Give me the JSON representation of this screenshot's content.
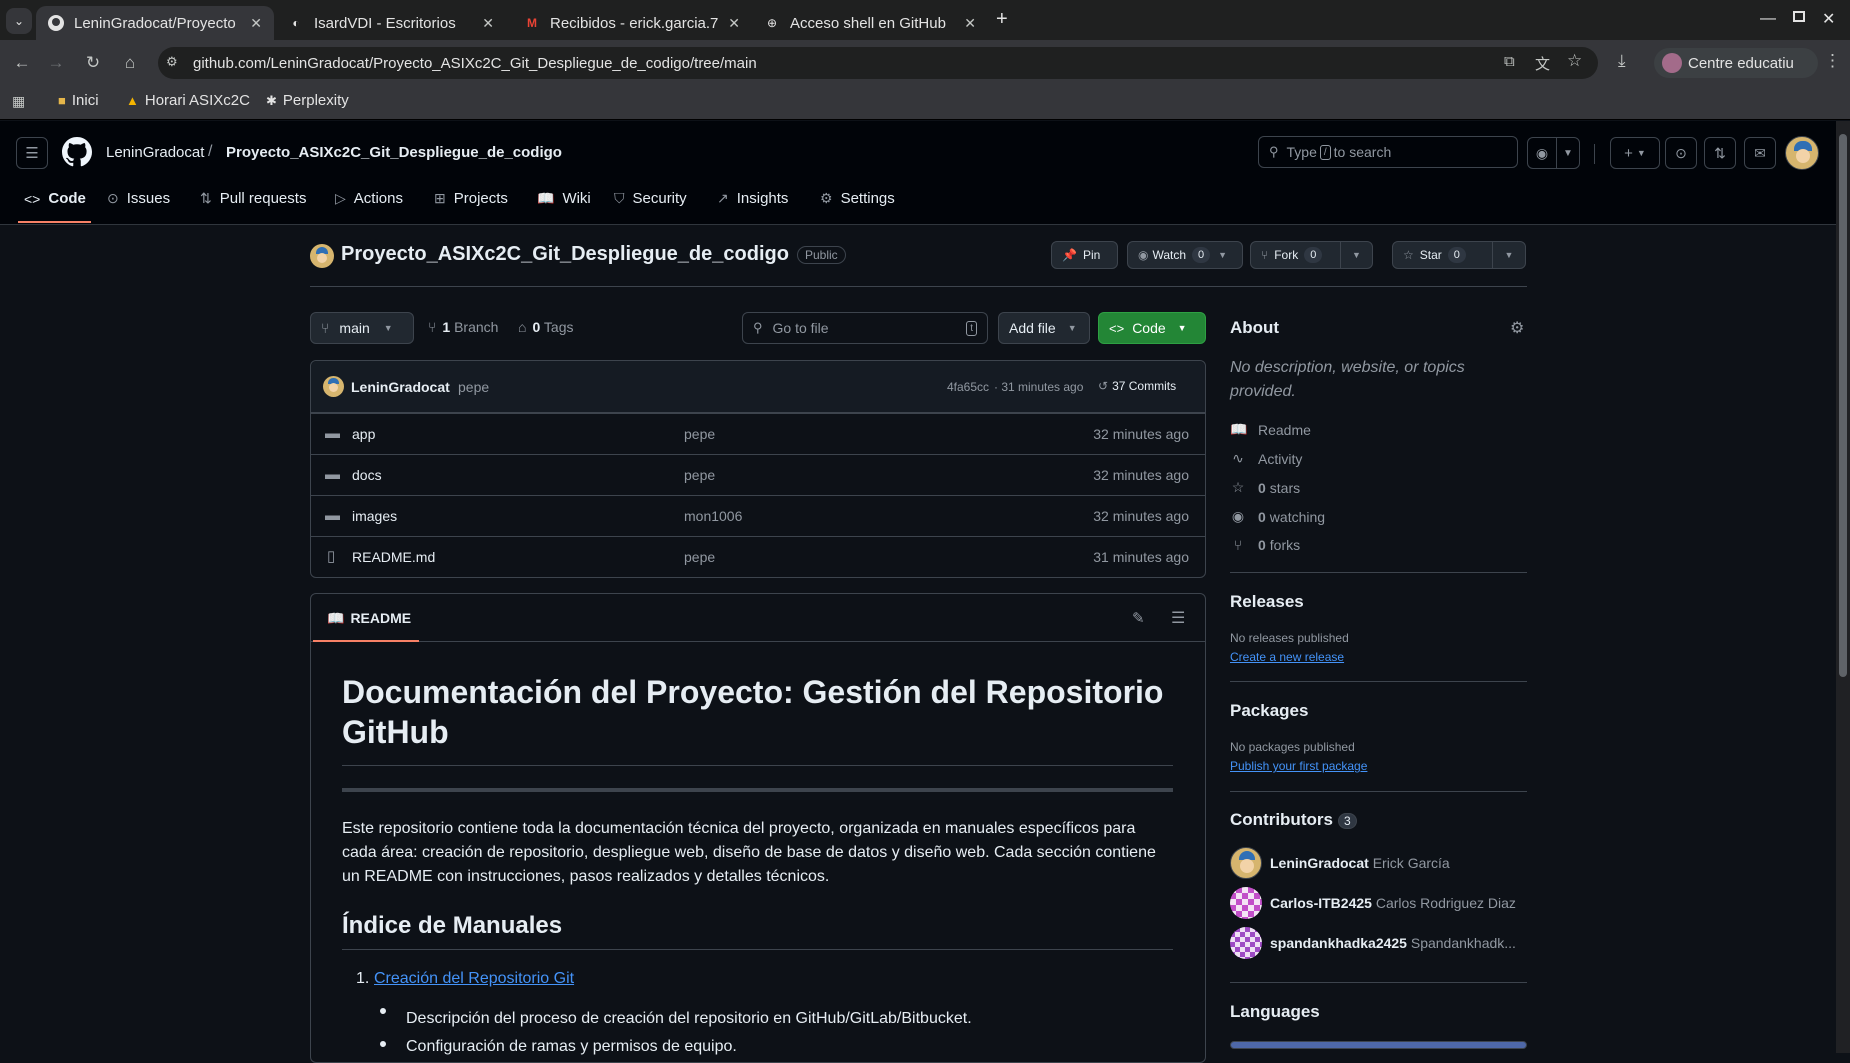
{
  "browser": {
    "tabs": [
      {
        "title": "LeninGradocat/Proyecto",
        "active": true
      },
      {
        "title": "IsardVDI - Escritorios",
        "active": false
      },
      {
        "title": "Recibidos - erick.garcia.7",
        "active": false
      },
      {
        "title": "Acceso shell en GitHub",
        "active": false
      }
    ],
    "new_tab": "+",
    "url": "github.com/LeninGradocat/Proyecto_ASIXc2C_Git_Despliegue_de_codigo/tree/main",
    "profile_label": "Centre educatiu",
    "bookmarks": [
      {
        "label": "Inici"
      },
      {
        "label": "Horari ASIXc2C"
      },
      {
        "label": "Perplexity"
      }
    ]
  },
  "github": {
    "owner": "LeninGradocat",
    "separator": "/",
    "repo": "Proyecto_ASIXc2C_Git_Despliegue_de_codigo",
    "search_pre": "Type",
    "search_key": "/",
    "search_post": "to search",
    "nav": [
      {
        "label": "Code",
        "icon": "code-icon"
      },
      {
        "label": "Issues",
        "icon": "issue-icon"
      },
      {
        "label": "Pull requests",
        "icon": "pull-request-icon"
      },
      {
        "label": "Actions",
        "icon": "play-icon"
      },
      {
        "label": "Projects",
        "icon": "table-icon"
      },
      {
        "label": "Wiki",
        "icon": "book-icon"
      },
      {
        "label": "Security",
        "icon": "shield-icon"
      },
      {
        "label": "Insights",
        "icon": "graph-icon"
      },
      {
        "label": "Settings",
        "icon": "gear-icon"
      }
    ]
  },
  "repo": {
    "title": "Proyecto_ASIXc2C_Git_Despliegue_de_codigo",
    "visibility": "Public",
    "pin": "Pin",
    "watch": "Watch",
    "watch_count": "0",
    "fork": "Fork",
    "fork_count": "0",
    "star": "Star",
    "star_count": "0",
    "branch": "main",
    "branches_count": "1",
    "branches_label": "Branch",
    "tags_count": "0",
    "tags_label": "Tags",
    "go_to_file": "Go to file",
    "go_to_file_key": "t",
    "add_file": "Add file",
    "code_button": "Code"
  },
  "commit": {
    "author": "LeninGradocat",
    "message": "pepe",
    "hash": "4fa65cc",
    "time": "· 31 minutes ago",
    "commits": "37 Commits"
  },
  "files": [
    {
      "name": "app",
      "type": "folder",
      "message": "pepe",
      "time": "32 minutes ago"
    },
    {
      "name": "docs",
      "type": "folder",
      "message": "pepe",
      "time": "32 minutes ago"
    },
    {
      "name": "images",
      "type": "folder",
      "message": "mon1006",
      "time": "32 minutes ago"
    },
    {
      "name": "README.md",
      "type": "file",
      "message": "pepe",
      "time": "31 minutes ago"
    }
  ],
  "readme": {
    "tab": "README",
    "h1": "Documentación del Proyecto: Gestión del Repositorio GitHub",
    "intro": "Este repositorio contiene toda la documentación técnica del proyecto, organizada en manuales específicos para cada área: creación de repositorio, despliegue web, diseño de base de datos y diseño web. Cada sección contiene un README con instrucciones, pasos realizados y detalles técnicos.",
    "h2": "Índice de Manuales",
    "item1_num": "1.",
    "item1_link": "Creación del Repositorio Git",
    "bullet1": "Descripción del proceso de creación del repositorio en GitHub/GitLab/Bitbucket.",
    "bullet2": "Configuración de ramas y permisos de equipo."
  },
  "sidebar": {
    "about": "About",
    "description": "No description, website, or topics provided.",
    "readme": "Readme",
    "activity": "Activity",
    "stars_count": "0",
    "stars": "stars",
    "watching_count": "0",
    "watching": "watching",
    "forks_count": "0",
    "forks": "forks",
    "releases": "Releases",
    "no_releases": "No releases published",
    "create_release": "Create a new release",
    "packages": "Packages",
    "no_packages": "No packages published",
    "publish_package": "Publish your first package",
    "contributors": "Contributors",
    "contributors_count": "3",
    "contributor_list": [
      {
        "login": "LeninGradocat",
        "name": "Erick García"
      },
      {
        "login": "Carlos-ITB2425",
        "name": "Carlos Rodriguez Diaz"
      },
      {
        "login": "spandankhadka2425",
        "name": "Spandankhadk..."
      }
    ],
    "languages": "Languages"
  },
  "colors": {
    "accent_green": "#238636",
    "link_blue": "#4493f8",
    "tab_underline": "#f78166",
    "folder": "#9198a1"
  }
}
